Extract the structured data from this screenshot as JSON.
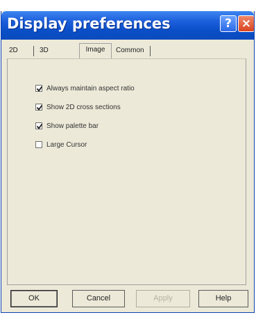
{
  "window": {
    "title": "Display preferences",
    "help_glyph": "?",
    "close_glyph": "×"
  },
  "tabs": [
    {
      "label": "2D",
      "active": false
    },
    {
      "label": "3D",
      "active": false
    },
    {
      "label": "Image",
      "active": true
    },
    {
      "label": "Common",
      "active": false
    }
  ],
  "options": [
    {
      "label": "Always maintain aspect ratio",
      "checked": true
    },
    {
      "label": "Show 2D cross sections",
      "checked": true
    },
    {
      "label": "Show palette bar",
      "checked": true
    },
    {
      "label": "Large Cursor",
      "checked": false
    }
  ],
  "buttons": {
    "ok": "OK",
    "cancel": "Cancel",
    "apply": "Apply",
    "help": "Help"
  },
  "icons": {
    "help": "help-icon",
    "close": "close-icon",
    "check": "checkmark-icon"
  },
  "colors": {
    "titlebar": "#0a4ec7",
    "dialog_bg": "#ece9d8",
    "close_red": "#d9441f"
  }
}
